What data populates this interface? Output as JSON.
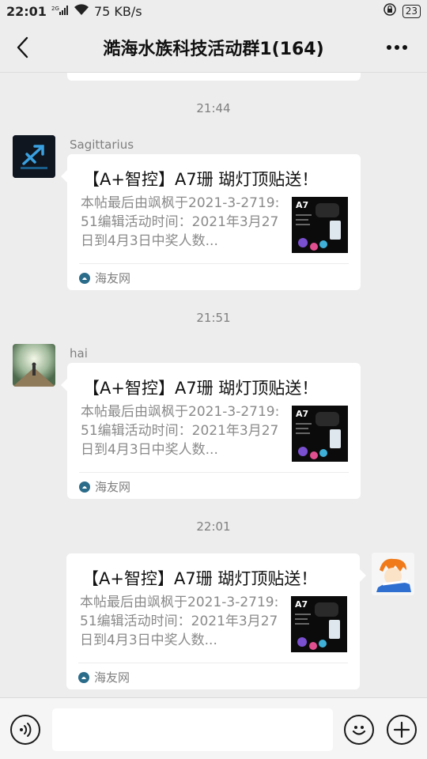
{
  "status_bar": {
    "time": "22:01",
    "network_speed": "75 KB/s",
    "battery": "23"
  },
  "header": {
    "title": "澔海水族科技活动群1(164)"
  },
  "messages": [
    {
      "timestamp": "21:44",
      "sender": "Sagittarius",
      "card": {
        "title": "【A+智控】A7珊 瑚灯顶贴送！",
        "description": "本帖最后由飒枫于2021-3-2719:51编辑活动时间：2021年3月27日到4月3日中奖人数...",
        "source": "海友网",
        "thumb_label": "A7"
      }
    },
    {
      "timestamp": "21:51",
      "sender": "hai",
      "card": {
        "title": "【A+智控】A7珊 瑚灯顶贴送！",
        "description": "本帖最后由飒枫于2021-3-2719:51编辑活动时间：2021年3月27日到4月3日中奖人数...",
        "source": "海友网",
        "thumb_label": "A7"
      }
    },
    {
      "timestamp": "22:01",
      "sender": "",
      "card": {
        "title": "【A+智控】A7珊 瑚灯顶贴送！",
        "description": "本帖最后由飒枫于2021-3-2719:51编辑活动时间：2021年3月27日到4月3日中奖人数...",
        "source": "海友网",
        "thumb_label": "A7"
      }
    }
  ],
  "colors": {
    "background": "#ededed",
    "card": "#ffffff",
    "muted_text": "#7f7f7f"
  },
  "icons": {
    "back": "chevron-left-icon",
    "more": "more-dots-icon",
    "voice": "voice-icon",
    "emoji": "emoji-icon",
    "plus": "plus-icon"
  }
}
